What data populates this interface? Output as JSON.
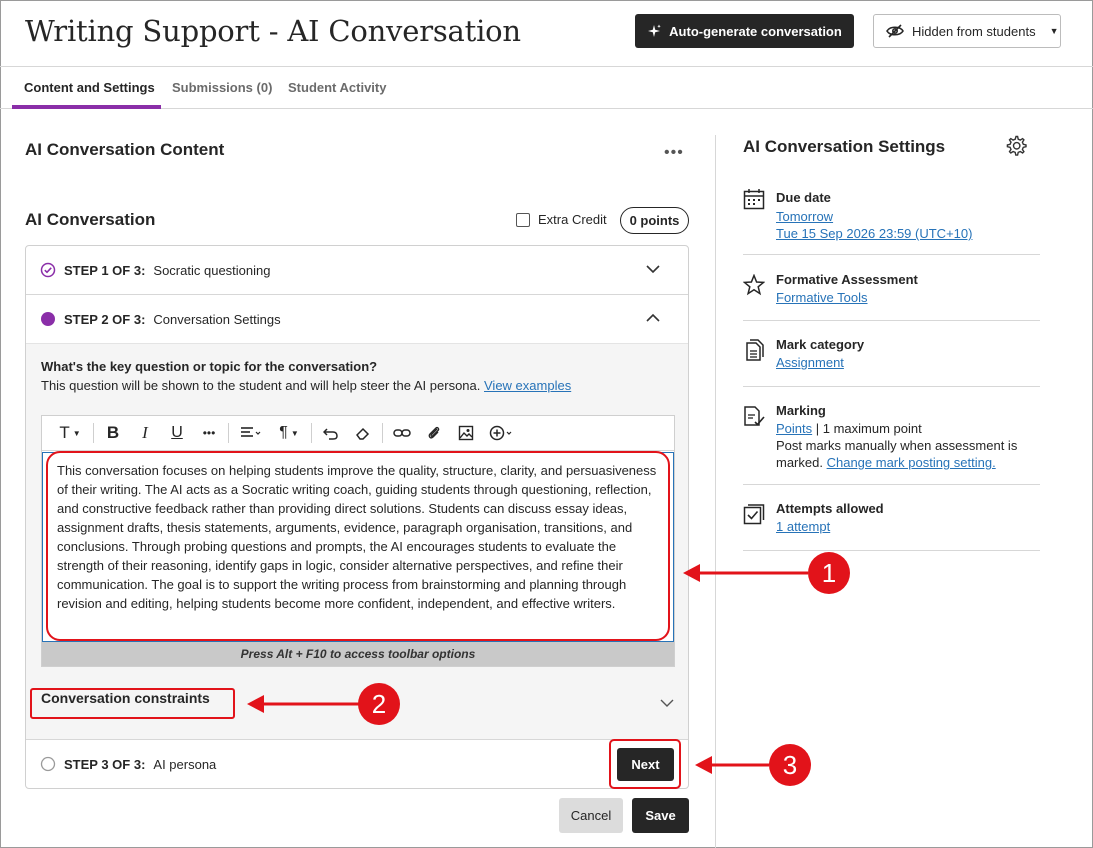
{
  "header": {
    "title": "Writing Support - AI Conversation",
    "autogen_label": "Auto-generate conversation",
    "visibility_label": "Hidden from students"
  },
  "tabs": [
    {
      "label": "Content and Settings",
      "active": true
    },
    {
      "label": "Submissions (0)",
      "active": false
    },
    {
      "label": "Student Activity",
      "active": false
    }
  ],
  "content": {
    "section_title": "AI Conversation Content",
    "conversation_title": "AI Conversation",
    "extra_credit_label": "Extra Credit",
    "extra_credit_checked": false,
    "points": "0 points",
    "steps": [
      {
        "number": "STEP 1 OF 3:",
        "label": "Socratic questioning",
        "status": "completed"
      },
      {
        "number": "STEP 2 OF 3:",
        "label": "Conversation Settings",
        "status": "current"
      },
      {
        "number": "STEP 3 OF 3:",
        "label": "AI persona",
        "status": "pending"
      }
    ],
    "question_title": "What's the key question or topic for the conversation?",
    "question_desc": "This question will be shown to the student and will help steer the AI persona.",
    "view_examples": "View examples",
    "editor_text": "This conversation focuses on helping students improve the quality, structure, clarity, and persuasiveness of their writing. The AI acts as a Socratic writing coach, guiding students through questioning, reflection, and constructive feedback rather than providing direct solutions. Students can discuss essay ideas, assignment drafts, thesis statements, arguments, evidence, paragraph organisation, transitions, and conclusions. Through probing questions and prompts, the AI encourages students to evaluate the strength of their reasoning, identify gaps in logic, consider alternative perspectives, and refine their communication. The goal is to support the writing process from brainstorming and planning through revision and editing, helping students become more confident, independent, and effective writers.",
    "editor_hint": "Press Alt + F10 to access toolbar options",
    "constraints_label": "Conversation constraints",
    "next_label": "Next",
    "cancel_label": "Cancel",
    "save_label": "Save"
  },
  "settings": {
    "title": "AI Conversation Settings",
    "due": {
      "head": "Due date",
      "link1": "Tomorrow",
      "link2": "Tue 15 Sep 2026 23:59 (UTC+10)"
    },
    "formative": {
      "head": "Formative Assessment",
      "link": "Formative Tools"
    },
    "category": {
      "head": "Mark category",
      "link": "Assignment"
    },
    "marking": {
      "head": "Marking",
      "link": "Points",
      "after_link": " | 1 maximum point",
      "post_text": "Post marks manually when assessment is marked.",
      "post_link": "Change mark posting setting."
    },
    "attempts": {
      "head": "Attempts allowed",
      "link": "1 attempt"
    }
  },
  "annotations": {
    "one": "1",
    "two": "2",
    "three": "3"
  },
  "colors": {
    "accent_purple": "#8a2ea8",
    "link_blue": "#2773b8",
    "annotation_red": "#e2131a",
    "dark_button": "#262626"
  }
}
